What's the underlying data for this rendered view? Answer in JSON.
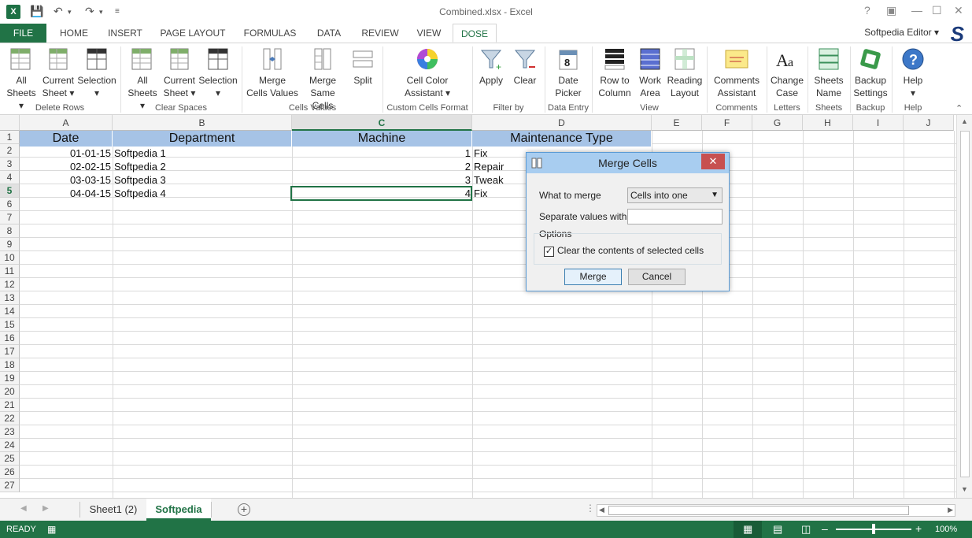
{
  "window": {
    "title": "Combined.xlsx - Excel",
    "user": "Softpedia Editor"
  },
  "ribbon_tabs": [
    "FILE",
    "HOME",
    "INSERT",
    "PAGE LAYOUT",
    "FORMULAS",
    "DATA",
    "REVIEW",
    "VIEW",
    "DOSE"
  ],
  "ribbon": {
    "delete_rows": {
      "group": "Delete Rows",
      "b1a": "All",
      "b1b": "Sheets",
      "b2a": "Current",
      "b2b": "Sheet",
      "b3a": "Selection",
      "b3b": ""
    },
    "clear_spaces": {
      "group": "Clear Spaces",
      "b1a": "All",
      "b1b": "Sheets",
      "b2a": "Current",
      "b2b": "Sheet",
      "b3a": "Selection",
      "b3b": ""
    },
    "cells_values": {
      "group": "Cells Values",
      "b1a": "Merge",
      "b1b": "Cells Values",
      "b2a": "Merge",
      "b2b": "Same Cells",
      "b3a": "Split"
    },
    "custom_format": {
      "group": "Custom Cells Format",
      "b1a": "Cell Color",
      "b1b": "Assistant"
    },
    "filter_by": {
      "group": "Filter by",
      "b1": "Apply",
      "b2": "Clear"
    },
    "data_entry": {
      "group": "Data Entry",
      "b1a": "Date",
      "b1b": "Picker"
    },
    "view": {
      "group": "View",
      "b1a": "Row to",
      "b1b": "Column",
      "b2a": "Work",
      "b2b": "Area",
      "b3a": "Reading",
      "b3b": "Layout"
    },
    "comments": {
      "group": "Comments",
      "b1a": "Comments",
      "b1b": "Assistant"
    },
    "letters": {
      "group": "Letters",
      "b1a": "Change",
      "b1b": "Case"
    },
    "sheets": {
      "group": "Sheets",
      "b1a": "Sheets",
      "b1b": "Name"
    },
    "backup": {
      "group": "Backup",
      "b1a": "Backup",
      "b1b": "Settings"
    },
    "help": {
      "group": "Help",
      "b1": "Help"
    }
  },
  "columns": [
    "A",
    "B",
    "C",
    "D",
    "E",
    "F",
    "G",
    "H",
    "I",
    "J"
  ],
  "rows": [
    "1",
    "2",
    "3",
    "4",
    "5",
    "6",
    "7",
    "8",
    "9",
    "10",
    "11",
    "12",
    "13",
    "14",
    "15",
    "16",
    "17",
    "18",
    "19",
    "20",
    "21",
    "22",
    "23",
    "24",
    "25",
    "26",
    "27"
  ],
  "table": {
    "headers": [
      "Date",
      "Department",
      "Machine",
      "Maintenance Type"
    ],
    "rows": [
      [
        "01-01-15",
        "Softpedia 1",
        "1",
        "Fix"
      ],
      [
        "02-02-15",
        "Softpedia 2",
        "2",
        "Repair"
      ],
      [
        "03-03-15",
        "Softpedia 3",
        "3",
        "Tweak"
      ],
      [
        "04-04-15",
        "Softpedia 4",
        "4",
        "Fix"
      ]
    ]
  },
  "sheet_tabs": [
    "Sheet1 (2)",
    "Softpedia"
  ],
  "status": {
    "ready": "READY",
    "zoom": "100%"
  },
  "dialog": {
    "title": "Merge Cells",
    "what_label": "What to merge",
    "what_value": "Cells into one",
    "separate_label": "Separate values with",
    "separate_value": "",
    "options_label": "Options",
    "clear_label": "Clear the contents of selected cells",
    "clear_checked": true,
    "merge_button": "Merge",
    "cancel_button": "Cancel"
  }
}
